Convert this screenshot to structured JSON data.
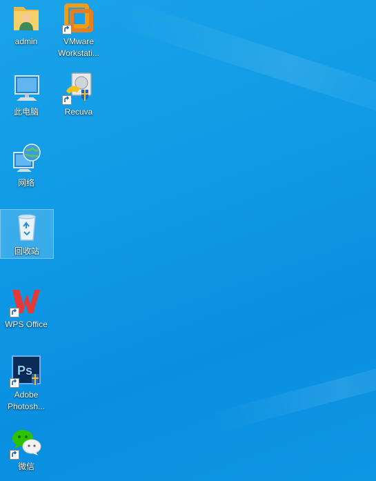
{
  "desktop": {
    "icons": [
      {
        "label": "admin"
      },
      {
        "label": "VMware Workstati..."
      },
      {
        "label": "此电脑"
      },
      {
        "label": "Recuva"
      },
      {
        "label": "网络"
      },
      {
        "label": "回收站"
      },
      {
        "label": "WPS Office"
      },
      {
        "label": "Adobe Photosh..."
      },
      {
        "label": "微信"
      }
    ]
  },
  "colors": {
    "desktop_background": "#0f9ae6",
    "selection": "#ffffff"
  }
}
